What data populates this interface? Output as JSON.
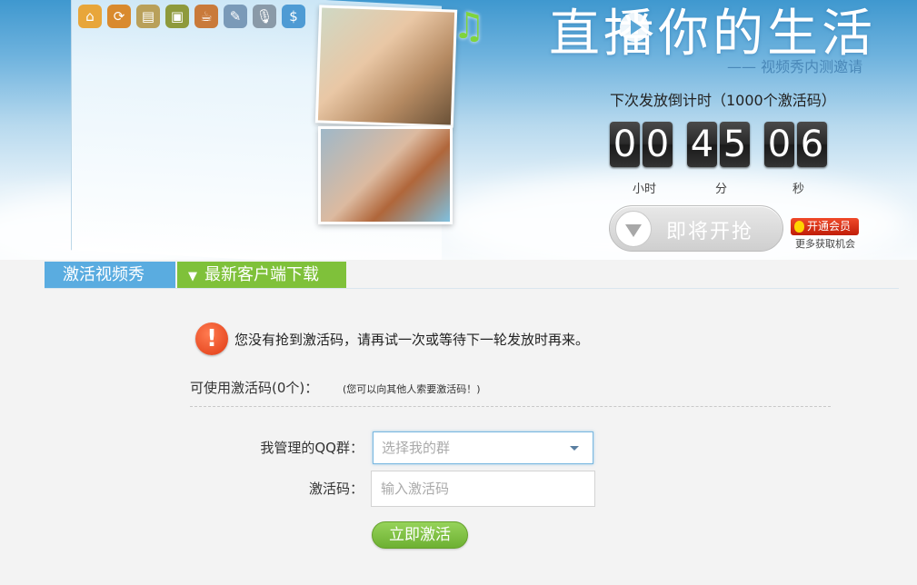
{
  "banner": {
    "slogan": "直播你的生活",
    "subslogan": "—— 视频秀内测邀请",
    "countdown_title": "下次发放倒计时（1000个激活码）",
    "countdown": {
      "hours": [
        "0",
        "0"
      ],
      "minutes": [
        "4",
        "5"
      ],
      "seconds": [
        "0",
        "6"
      ]
    },
    "units": {
      "hours": "小时",
      "minutes": "分",
      "seconds": "秒"
    },
    "grab_button": "即将开抢",
    "vip_button": "开通会员",
    "vip_sub": "更多获取机会"
  },
  "tabs": [
    {
      "label": "激活视频秀"
    },
    {
      "label": "最新客户端下载",
      "arrow": "▼"
    }
  ],
  "alert": {
    "symbol": "!",
    "message": "您没有抢到激活码，请再试一次或等待下一轮发放时再来。"
  },
  "codes": {
    "title": "可使用激活码(0个)：",
    "hint": "(您可以向其他人索要激活码！)"
  },
  "form": {
    "group_label": "我管理的QQ群：",
    "group_placeholder": "选择我的群",
    "code_label": "激活码：",
    "code_placeholder": "输入激活码",
    "activate_label": "立即激活"
  },
  "icons": {
    "toolbar": [
      "home-icon",
      "sync-icon",
      "film-icon",
      "video-icon",
      "coffee-icon",
      "note-add-icon",
      "microphone-icon",
      "coin-icon"
    ],
    "note": "music-note-icon"
  }
}
